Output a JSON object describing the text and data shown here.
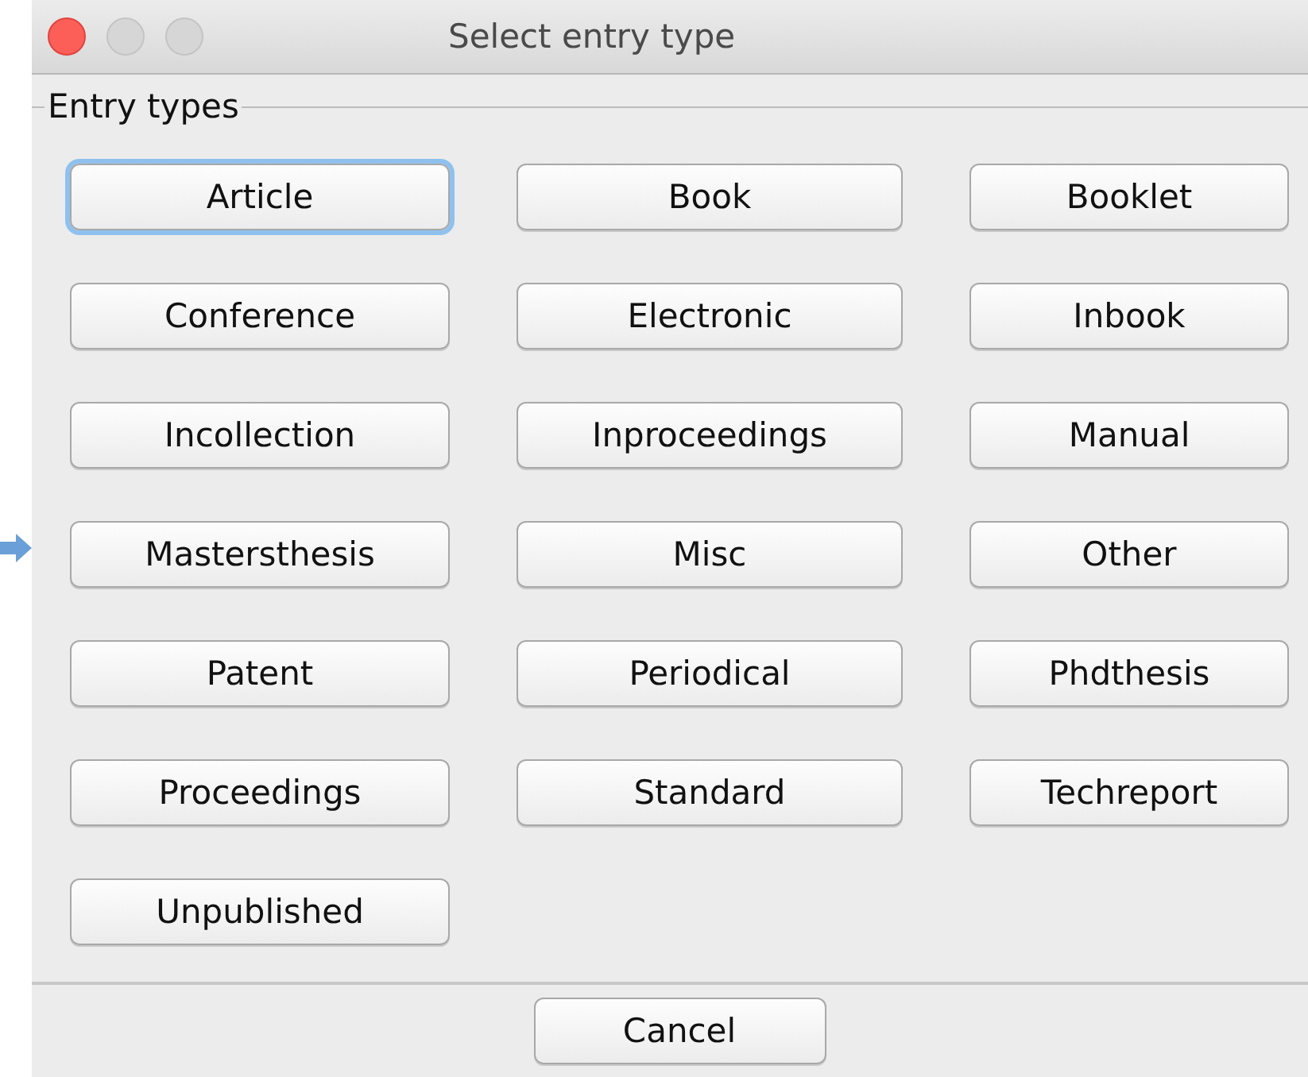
{
  "window": {
    "title": "Select entry type"
  },
  "entry_types": {
    "legend": "Entry types",
    "buttons": [
      {
        "label": "Article",
        "focused": true
      },
      {
        "label": "Book",
        "focused": false
      },
      {
        "label": "Booklet",
        "focused": false
      },
      {
        "label": "Conference",
        "focused": false
      },
      {
        "label": "Electronic",
        "focused": false
      },
      {
        "label": "Inbook",
        "focused": false
      },
      {
        "label": "Incollection",
        "focused": false
      },
      {
        "label": "Inproceedings",
        "focused": false
      },
      {
        "label": "Manual",
        "focused": false
      },
      {
        "label": "Mastersthesis",
        "focused": false
      },
      {
        "label": "Misc",
        "focused": false
      },
      {
        "label": "Other",
        "focused": false
      },
      {
        "label": "Patent",
        "focused": false
      },
      {
        "label": "Periodical",
        "focused": false
      },
      {
        "label": "Phdthesis",
        "focused": false
      },
      {
        "label": "Proceedings",
        "focused": false
      },
      {
        "label": "Standard",
        "focused": false
      },
      {
        "label": "Techreport",
        "focused": false
      },
      {
        "label": "Unpublished",
        "focused": false
      }
    ]
  },
  "footer": {
    "buttons": [
      "Cancel"
    ]
  }
}
